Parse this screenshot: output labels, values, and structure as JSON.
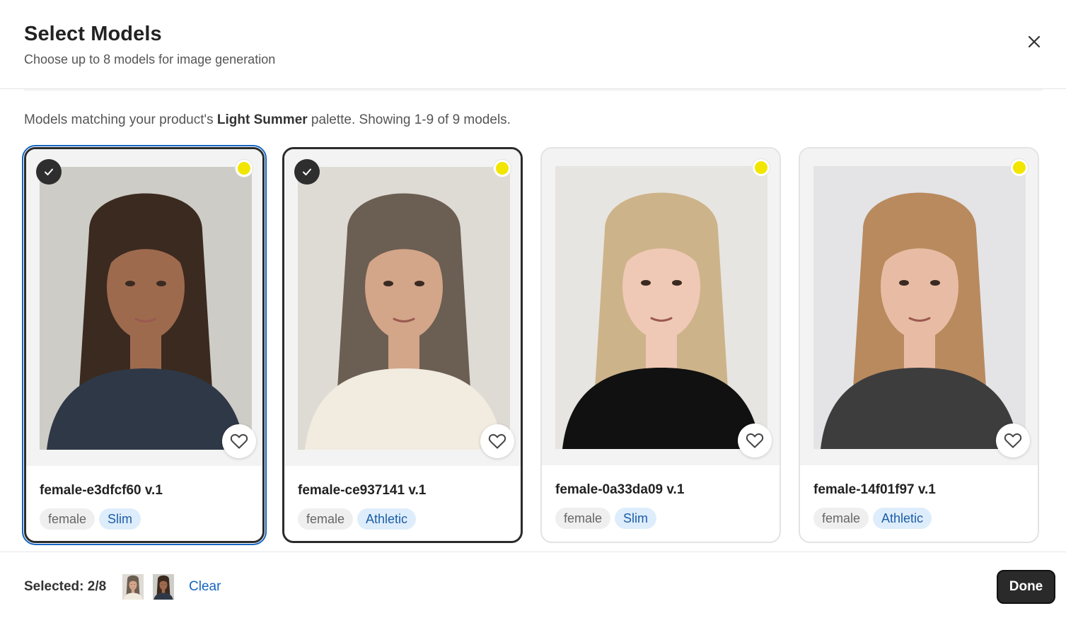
{
  "header": {
    "title": "Select Models",
    "subtitle": "Choose up to 8 models for image generation",
    "close_icon": "close-icon"
  },
  "info": {
    "prefix": "Models matching your product's ",
    "palette": "Light Summer",
    "suffix": " palette. Showing 1-9 of 9 models."
  },
  "models": [
    {
      "name": "female-e3dfcf60 v.1",
      "gender": "female",
      "body_type": "Slim",
      "selected": true,
      "hair": "#3b2a1f",
      "skin": "#9e6a4e",
      "top": "#2f3846",
      "backdrop": "#cdccc6"
    },
    {
      "name": "female-ce937141 v.1",
      "gender": "female",
      "body_type": "Athletic",
      "selected": true,
      "hair": "#6b5e52",
      "skin": "#d3a589",
      "top": "#f1ebe0",
      "backdrop": "#dedad4"
    },
    {
      "name": "female-0a33da09 v.1",
      "gender": "female",
      "body_type": "Slim",
      "selected": false,
      "hair": "#cdb38a",
      "skin": "#efc9b6",
      "top": "#111111",
      "backdrop": "#e7e5e1"
    },
    {
      "name": "female-14f01f97 v.1",
      "gender": "female",
      "body_type": "Athletic",
      "selected": false,
      "hair": "#b98a5e",
      "skin": "#e8bca4",
      "top": "#3d3d3d",
      "backdrop": "#e4e4e6"
    }
  ],
  "palette_color": "#f2e600",
  "footer": {
    "selected_label": "Selected: 2/8",
    "clear_label": "Clear",
    "done_label": "Done"
  }
}
